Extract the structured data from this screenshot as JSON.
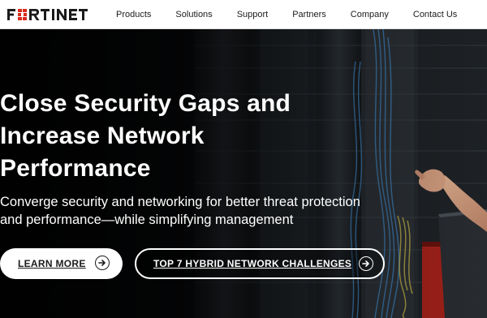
{
  "brand": {
    "logo_text": "FORTINET",
    "logo_color": "#da291c"
  },
  "nav": {
    "items": [
      {
        "label": "Products"
      },
      {
        "label": "Solutions"
      },
      {
        "label": "Support"
      },
      {
        "label": "Partners"
      },
      {
        "label": "Company"
      },
      {
        "label": "Contact Us"
      }
    ]
  },
  "hero": {
    "title_lines": [
      "Close Security Gaps and",
      "Increase Network",
      "Performance"
    ],
    "subtitle_lines": [
      "Converge security and networking for better threat protection",
      "and performance—while simplifying management"
    ],
    "primary_cta": {
      "label": "LEARN MORE",
      "icon": "arrow-right-circle-icon"
    },
    "secondary_cta": {
      "label": "TOP 7 HYBRID NETWORK CHALLENGES",
      "icon": "arrow-right-circle-icon"
    },
    "text_color": "#ffffff",
    "background": "dark data-center server rack photo with a hand at the right"
  }
}
